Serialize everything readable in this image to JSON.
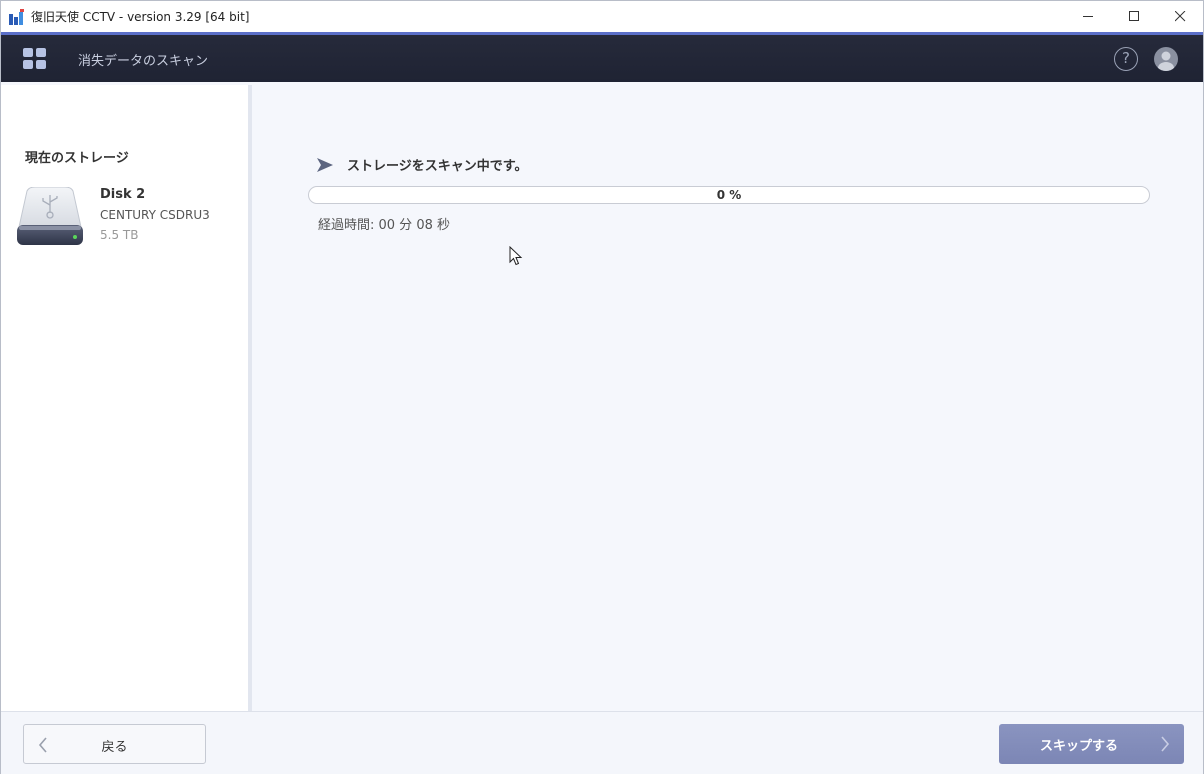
{
  "window": {
    "title": "復旧天使 CCTV - version 3.29 [64 bit]"
  },
  "header": {
    "title": "消失データのスキャン",
    "help_glyph": "?"
  },
  "sidebar": {
    "heading": "現在のストレージ",
    "disk": {
      "name": "Disk 2",
      "model": "CENTURY CSDRU3",
      "size": "5.5 TB"
    }
  },
  "main": {
    "status": "ストレージをスキャン中です。",
    "progress_value": 0,
    "progress_label": "0 %",
    "elapsed": "経過時間: 00 分 08 秒"
  },
  "footer": {
    "back_label": "戻る",
    "skip_label": "スキップする"
  },
  "colors": {
    "accent": "#5b6fc8",
    "header_bg": "#22263a",
    "skip_button": "#8088b8"
  }
}
